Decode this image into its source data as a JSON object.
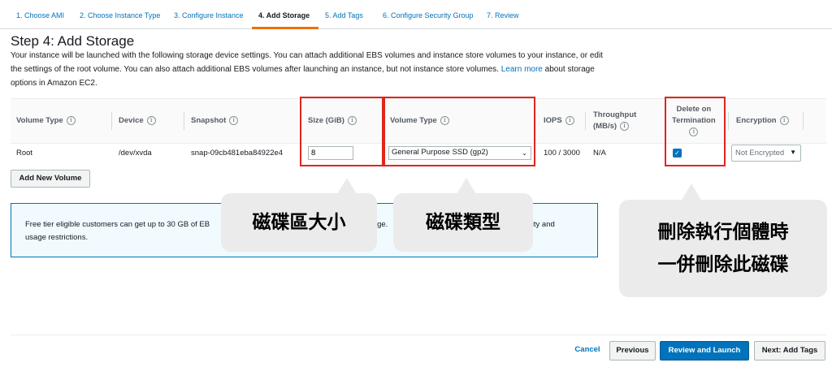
{
  "tabs": [
    {
      "label": "1. Choose AMI"
    },
    {
      "label": "2. Choose Instance Type"
    },
    {
      "label": "3. Configure Instance"
    },
    {
      "label": "4. Add Storage"
    },
    {
      "label": "5. Add Tags"
    },
    {
      "label": "6. Configure Security Group"
    },
    {
      "label": "7. Review"
    }
  ],
  "page": {
    "title": "Step 4: Add Storage",
    "description": "Your instance will be launched with the following storage device settings. You can attach additional EBS volumes and instance store volumes to your instance, or edit the settings of the root volume. You can also attach additional EBS volumes after launching an instance, but not instance store volumes.",
    "learn_more": "Learn more",
    "description_tail": "about storage options in Amazon EC2."
  },
  "table": {
    "headers": {
      "volume_type": "Volume Type",
      "device": "Device",
      "snapshot": "Snapshot",
      "size": "Size (GiB)",
      "volume_type2": "Volume Type",
      "iops": "IOPS",
      "throughput_1": "Throughput",
      "throughput_2": "(MB/s)",
      "delete_1": "Delete on",
      "delete_2": "Termination",
      "encryption": "Encryption"
    },
    "row": {
      "volume_type": "Root",
      "device": "/dev/xvda",
      "snapshot": "snap-09cb481eba84922e4",
      "size": "8",
      "volume_type_select": "General Purpose SSD (gp2)",
      "iops": "100 / 3000",
      "throughput": "N/A",
      "delete_on_termination": true,
      "encryption": "Not Encrypted"
    },
    "add_volume_label": "Add New Volume"
  },
  "infobox": {
    "text_start": "Free tier eligible customers can get up to 30 GB of EB",
    "text_mid": "ge.",
    "text_end": "bility and",
    "text_line2": "usage restrictions."
  },
  "callouts": {
    "size": "磁碟區大小",
    "type": "磁碟類型",
    "delete_line1": "刪除執行個體時",
    "delete_line2": "一併刪除此磁碟"
  },
  "footer": {
    "cancel": "Cancel",
    "previous": "Previous",
    "review_launch": "Review and Launch",
    "next": "Next: Add Tags"
  },
  "colors": {
    "accent": "#ec7211",
    "link": "#0073bb",
    "highlight": "#e0261d"
  }
}
